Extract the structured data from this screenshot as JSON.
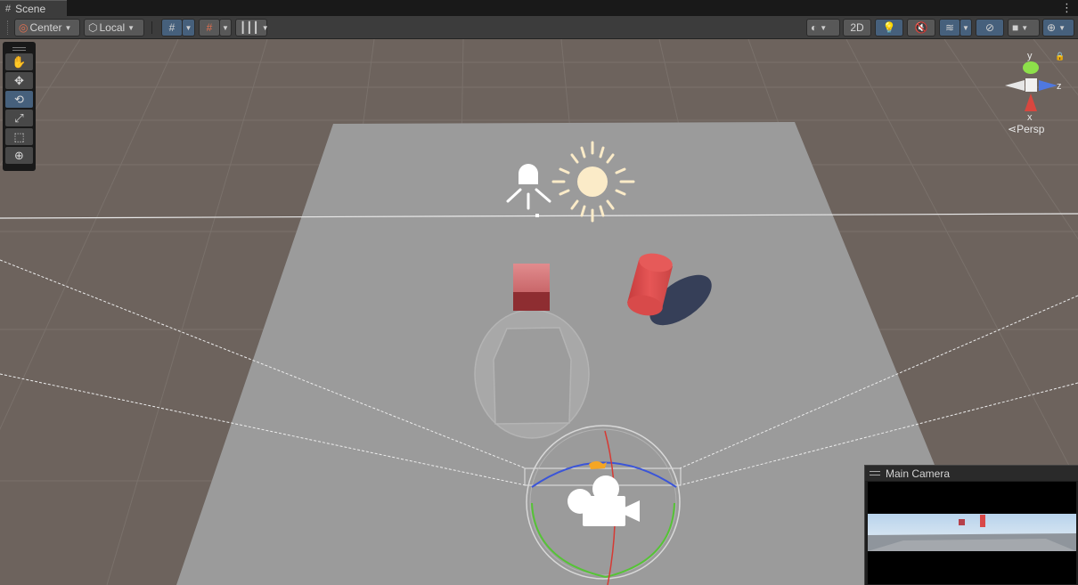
{
  "window": {
    "tab_label": "Scene"
  },
  "toolbar": {
    "pivot_mode": "Center",
    "pivot_rotation": "Local",
    "mode_2d": "2D"
  },
  "tools": [
    {
      "name": "view-tool",
      "icon": "hand-icon",
      "glyph": "✋"
    },
    {
      "name": "move-tool",
      "icon": "move-icon",
      "glyph": "✥"
    },
    {
      "name": "rotate-tool",
      "icon": "rotate-icon",
      "glyph": "⟲",
      "active": true
    },
    {
      "name": "scale-tool",
      "icon": "scale-icon",
      "glyph": "⤢"
    },
    {
      "name": "rect-tool",
      "icon": "rect-icon",
      "glyph": "⬚"
    },
    {
      "name": "transform-tool",
      "icon": "transform-icon",
      "glyph": "⊕"
    }
  ],
  "gizmo": {
    "axis_y": "y",
    "axis_z": "z",
    "axis_x": "x",
    "projection": "Persp"
  },
  "camera_preview": {
    "title": "Main Camera"
  },
  "colors": {
    "accent_blue": "#46607c",
    "ground": "#6d635d",
    "plane": "#9a9a9a",
    "cube": "#d06468",
    "cylinder": "#e0504f",
    "sun": "#fbebc8"
  }
}
